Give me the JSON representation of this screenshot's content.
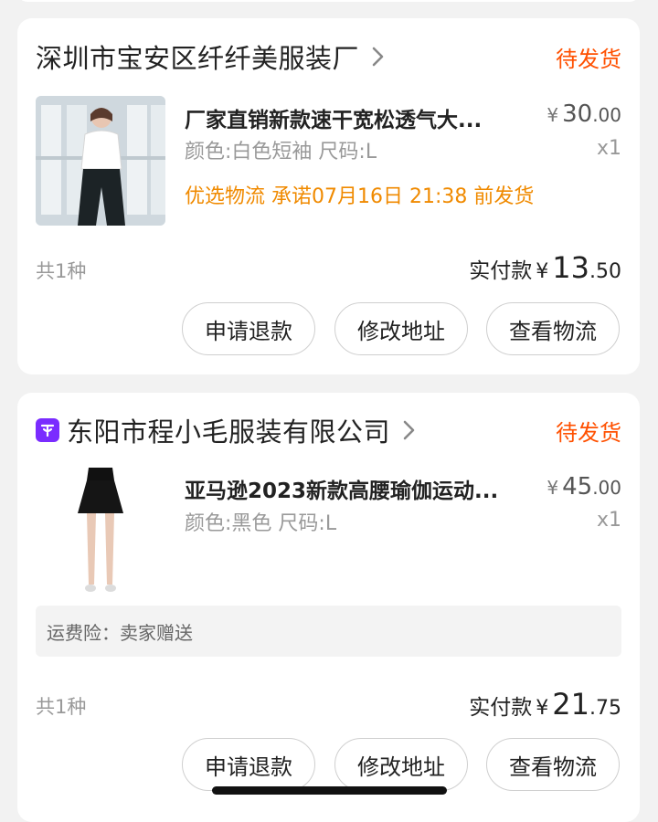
{
  "orders": [
    {
      "shop_name": "深圳市宝安区纤纤美服装厂",
      "status": "待发货",
      "item": {
        "title": "厂家直销新款速干宽松透气大...",
        "spec": "颜色:白色短袖 尺码:L",
        "promise": "优选物流 承诺07月16日 21:38 前发货",
        "price_symbol": "¥",
        "price_int": "30",
        "price_dec": ".00",
        "qty": "x1"
      },
      "count": "共1种",
      "paid_label": "实付款",
      "paid_symbol": "¥",
      "paid_int": "13",
      "paid_dec": ".50",
      "buttons": [
        "申请退款",
        "修改地址",
        "查看物流"
      ]
    },
    {
      "shop_name": "东阳市程小毛服装有限公司",
      "status": "待发货",
      "item": {
        "title": "亚马逊2023新款高腰瑜伽运动...",
        "spec": "颜色:黑色 尺码:L",
        "price_symbol": "¥",
        "price_int": "45",
        "price_dec": ".00",
        "qty": "x1"
      },
      "insurance": "运费险：卖家赠送",
      "count": "共1种",
      "paid_label": "实付款",
      "paid_symbol": "¥",
      "paid_int": "21",
      "paid_dec": ".75",
      "buttons": [
        "申请退款",
        "修改地址",
        "查看物流"
      ]
    }
  ],
  "colors": {
    "status": "#ff5000",
    "promise": "#f08a00",
    "shop_badge": "#7a2cff"
  },
  "icons": {
    "chevron": "chevron-right-icon",
    "shop_badge": "tmall-shop-icon"
  }
}
